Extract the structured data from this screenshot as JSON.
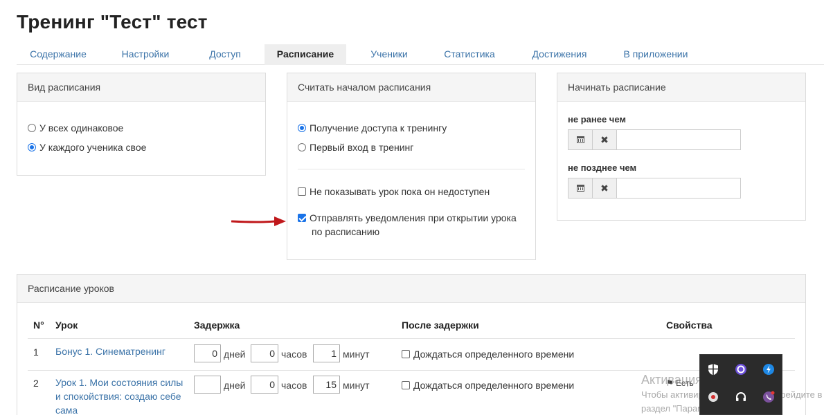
{
  "page": {
    "title": "Тренинг \"Тест\" тест"
  },
  "tabs": [
    {
      "label": "Содержание"
    },
    {
      "label": "Настройки"
    },
    {
      "label": "Доступ"
    },
    {
      "label": "Расписание",
      "active": true
    },
    {
      "label": "Ученики"
    },
    {
      "label": "Статистика"
    },
    {
      "label": "Достижения"
    },
    {
      "label": "В приложении"
    }
  ],
  "schedule_type": {
    "title": "Вид расписания",
    "options": [
      {
        "label": "У всех одинаковое",
        "selected": false
      },
      {
        "label": "У каждого ученика свое",
        "selected": true
      }
    ]
  },
  "schedule_start": {
    "title": "Считать началом расписания",
    "options": [
      {
        "label": "Получение доступа к тренингу",
        "selected": true
      },
      {
        "label": "Первый вход в тренинг",
        "selected": false
      }
    ],
    "checkboxes": [
      {
        "label": "Не показывать урок пока он недоступен",
        "checked": false
      },
      {
        "label": "Отправлять уведомления при открытии урока",
        "label2": "по расписанию",
        "checked": true
      }
    ]
  },
  "begin_schedule": {
    "title": "Начинать расписание",
    "not_earlier": "не ранее чем",
    "not_later": "не позднее чем",
    "not_earlier_value": "",
    "not_later_value": ""
  },
  "lessons": {
    "title": "Расписание уроков",
    "columns": {
      "num": "N°",
      "lesson": "Урок",
      "delay": "Задержка",
      "after": "После задержки",
      "props": "Свойства"
    },
    "units": {
      "days": "дней",
      "hours": "часов",
      "minutes": "минут"
    },
    "rows": [
      {
        "num": "1",
        "lesson": "Бонус 1. Синематренинг",
        "days": "0",
        "hours": "0",
        "minutes": "1",
        "wait_label": "Дождаться определенного времени"
      },
      {
        "num": "2",
        "lesson_lines": [
          "Урок 1. Мои состояния силы",
          "и спокойствия: создаю себе",
          "сама"
        ],
        "days": "",
        "hours": "0",
        "minutes": "15",
        "wait_label": "Дождаться определенного времени",
        "prop": "Есть"
      }
    ]
  },
  "os": {
    "activate_title": "Активация Windows",
    "activate_line1": "Чтобы активировать Windows, перейдите в",
    "activate_line2": "раздел \"Параметры\"."
  },
  "colors": {
    "link": "#3b73a8",
    "accent": "#1a73e8",
    "arrow": "#c0181b"
  }
}
